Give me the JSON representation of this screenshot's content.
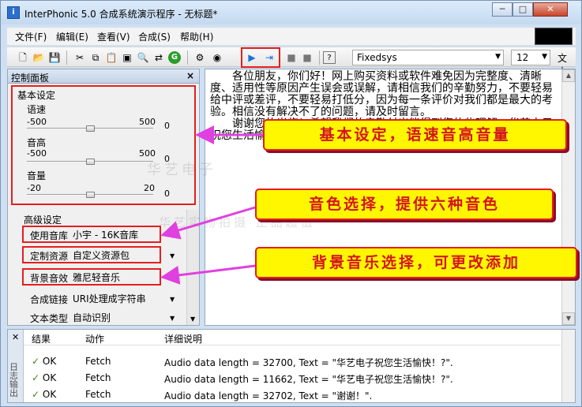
{
  "window": {
    "title": "InterPhonic 5.0 合成系统演示程序 - 无标题*",
    "app_icon": "i",
    "minimize": "─",
    "maximize": "□",
    "close": "✕"
  },
  "menu": [
    "文件(F)",
    "编辑(E)",
    "查看(V)",
    "合成(S)",
    "帮助(H)"
  ],
  "toolbar": {
    "font": "Fixedsys",
    "font_size": "12",
    "text_label": "文本",
    "icons": [
      "new-file-icon",
      "open-file-icon",
      "save-file-icon",
      "eraser-icon",
      "cut-icon",
      "copy-icon",
      "paste-icon",
      "image-icon",
      "find-icon",
      "replace-icon",
      "go-icon",
      "settings-icon",
      "voice-icon",
      "play-icon",
      "export-icon",
      "stop-icon",
      "pause-icon",
      "help-icon"
    ]
  },
  "control_panel": {
    "title": "控制面板",
    "basic": {
      "heading": "基本设定",
      "sliders": [
        {
          "label": "语速",
          "min": "-500",
          "max": "500",
          "value": "0"
        },
        {
          "label": "音高",
          "min": "-500",
          "max": "500",
          "value": "0"
        },
        {
          "label": "音量",
          "min": "-20",
          "max": "20",
          "value": "0"
        }
      ]
    },
    "advanced": {
      "heading": "高级设定",
      "rows": [
        {
          "label": "使用音库",
          "value": "小宇 - 16K音库"
        },
        {
          "label": "定制资源",
          "value": "自定义资源包"
        },
        {
          "label": "背景音效",
          "value": "雅尼轻音乐"
        },
        {
          "label": "合成链接",
          "value": "URI处理成字符串"
        },
        {
          "label": "文本类型",
          "value": "自动识别"
        }
      ]
    }
  },
  "editor": {
    "paragraphs": [
      "各位朋友，你们好！网上购买资料或软件难免因为完整度、清晰度、适用性等原因产生误会或误解，请相信我们的辛勤努力，不要轻易给中评或差评，不要轻易打低分，因为每一条评价对我们都是最大的考验。相信没有解决不了的问题，请及时留言。",
      "谢谢您的光临！希望我们的辛勤付出能得到您的些理解。华艺电子祝您生活愉快！谢谢！"
    ]
  },
  "log": {
    "side_close": "✕",
    "side_label": "日志输出",
    "columns": [
      "结果",
      "动作",
      "详细说明"
    ],
    "rows": [
      {
        "result": "OK",
        "action": "Fetch",
        "detail": "Audio data length = 32700, Text = \"华艺电子祝您生活愉快！?\"."
      },
      {
        "result": "OK",
        "action": "Fetch",
        "detail": "Audio data length = 11662, Text = \"华艺电子祝您生活愉快！?\"."
      },
      {
        "result": "OK",
        "action": "Fetch",
        "detail": "Audio data length = 32702, Text = \"谢谢！\"."
      }
    ]
  },
  "callouts": [
    "基本设定，语速音高音量",
    "音色选择，提供六种音色",
    "背景音乐选择，可更改添加"
  ],
  "watermark": [
    "华艺电子",
    "华艺实物拍摄 正品超值"
  ],
  "colors": {
    "callout_bg": "#fff700",
    "callout_text": "#d5141e",
    "highlight": "#e41f1f",
    "arrow": "#e040e0"
  }
}
